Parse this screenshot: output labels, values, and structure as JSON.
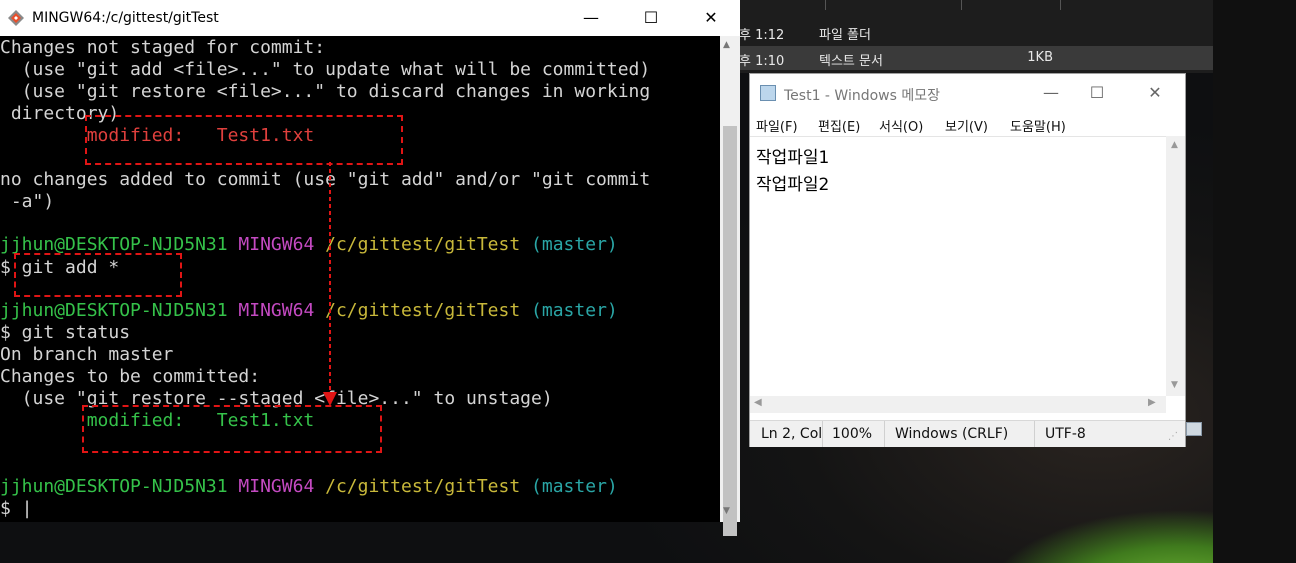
{
  "terminal": {
    "title": "MINGW64:/c/gittest/gitTest",
    "lines": {
      "l1": "Changes not staged for commit:",
      "l2": "  (use \"git add <file>...\" to update what will be committed)",
      "l3": "  (use \"git restore <file>...\" to discard changes in working",
      "l4": " directory)",
      "l5": "        modified:   Test1.txt",
      "l6": "no changes added to commit (use \"git add\" and/or \"git commit",
      "l7": " -a\")",
      "prompt_user": "jjhun@DESKTOP-NJD5N31",
      "prompt_shell": "MINGW64",
      "prompt_path": "/c/gittest/gitTest",
      "prompt_branch": "(master)",
      "cmd1": "$ git add *",
      "cmd2": "$ git status",
      "l8": "On branch master",
      "l9": "Changes to be committed:",
      "l10": "  (use \"git restore --staged <file>...\" to unstage)",
      "l11": "        modified:   Test1.txt",
      "cursor_prompt": "$ |"
    },
    "controls": {
      "minimize": "—",
      "maximize": "☐",
      "close": "✕"
    }
  },
  "explorer": {
    "rows": [
      {
        "time": "후 1:12",
        "type": "파일 폴더",
        "size": ""
      },
      {
        "time": "후 1:10",
        "type": "텍스트 문서",
        "size": "1KB"
      }
    ]
  },
  "notepad": {
    "title": "Test1 - Windows 메모장",
    "menu": [
      "파일(F)",
      "편집(E)",
      "서식(O)",
      "보기(V)",
      "도움말(H)"
    ],
    "text_lines": [
      "작업파일1",
      "작업파일2"
    ],
    "status": {
      "position": "Ln 2, Col",
      "zoom": "100%",
      "line_ending": "Windows (CRLF)",
      "encoding": "UTF-8"
    },
    "controls": {
      "minimize": "—",
      "maximize": "☐",
      "close": "✕"
    }
  },
  "colors": {
    "annotation": "#e01515",
    "modified_unstaged": "#e0403d",
    "modified_staged": "#35c24a",
    "prompt_user": "#35c24a",
    "prompt_shell": "#c44ac2",
    "prompt_path": "#c8b83a",
    "prompt_branch": "#2aa6a6"
  }
}
